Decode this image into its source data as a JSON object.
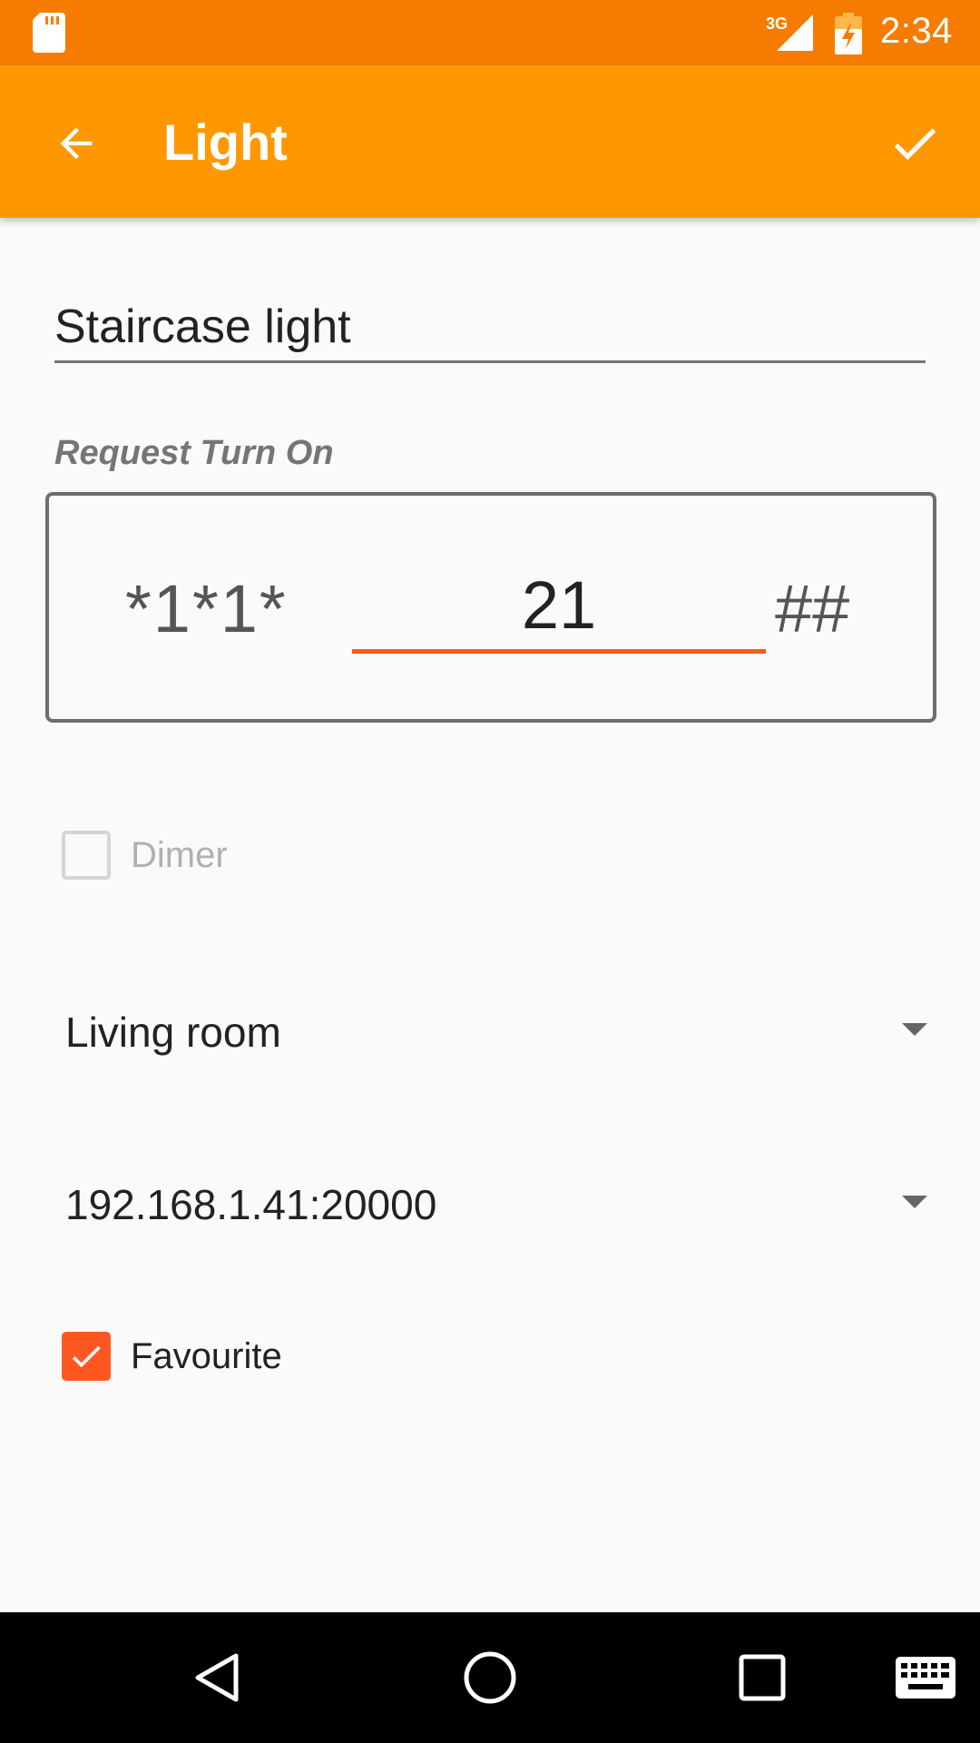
{
  "status_bar": {
    "time": "2:34",
    "network_label": "3G",
    "icons": [
      "sd-card-icon",
      "signal-3g-icon",
      "battery-charging-icon"
    ]
  },
  "app_bar": {
    "title": "Light",
    "back_icon": "arrow-back-icon",
    "confirm_icon": "check-icon"
  },
  "form": {
    "name_value": "Staircase light",
    "request_label": "Request Turn On",
    "code_prefix": "*1*1*",
    "code_value": "21",
    "code_suffix": "##",
    "dimer_label": "Dimer",
    "dimer_checked": false,
    "room_value": "Living room",
    "server_value": "192.168.1.41:20000",
    "favourite_label": "Favourite",
    "favourite_checked": true
  },
  "colors": {
    "status_bar": "#f57c00",
    "app_bar": "#ff9800",
    "accent": "#ff5722"
  },
  "nav_bar": {
    "icons": [
      "nav-back-icon",
      "nav-home-icon",
      "nav-recents-icon",
      "keyboard-icon"
    ]
  }
}
